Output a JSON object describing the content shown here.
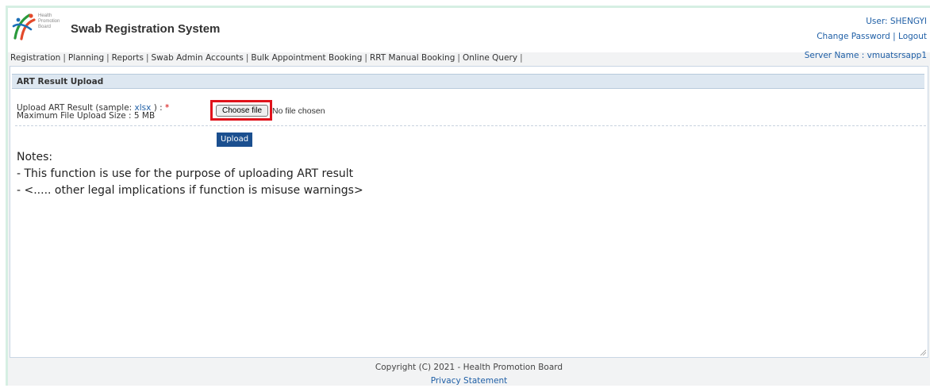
{
  "header": {
    "logo": {
      "line1": "Health",
      "line2": "Promotion",
      "line3": "Board"
    },
    "app_title": "Swab Registration System",
    "user_label": "User: SHENGYI",
    "change_password": "Change Password",
    "separator": "|",
    "logout": "Logout",
    "server_name": "Server Name : vmuatsrsapp1"
  },
  "nav": {
    "items": [
      {
        "label": "Registration"
      },
      {
        "label": "Planning"
      },
      {
        "label": "Reports"
      },
      {
        "label": "Swab Admin Accounts"
      },
      {
        "label": "Bulk Appointment Booking"
      },
      {
        "label": "RRT Manual Booking"
      },
      {
        "label": "Online Query"
      }
    ],
    "separator": "|"
  },
  "section": {
    "title": "ART Result Upload"
  },
  "form": {
    "label_prefix": "Upload ART Result (sample: ",
    "sample_link": "xlsx",
    "label_suffix": " ) : ",
    "required_mark": "*",
    "max_size": "Maximum File Upload Size : 5 MB",
    "choose_file": "Choose file",
    "no_file": "No file chosen",
    "upload": "Upload"
  },
  "notes": {
    "heading": "Notes:",
    "lines": [
      "- This function is use for the purpose of uploading ART result",
      "- <..... other legal implications if function is misuse warnings>"
    ]
  },
  "footer": {
    "copyright": "Copyright (C) 2021 - Health Promotion Board",
    "privacy": "Privacy Statement"
  },
  "colors": {
    "accent_link": "#1f5fa6",
    "section_header_bg": "#dde7f1",
    "upload_button": "#1b4f8f",
    "highlight_box": "#e0131b",
    "required": "#d40000"
  }
}
